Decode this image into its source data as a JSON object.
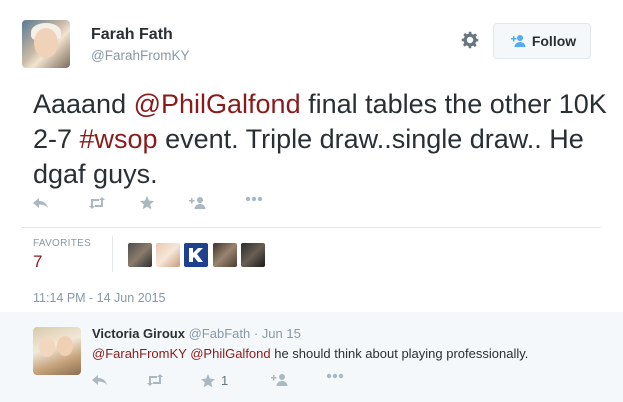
{
  "author": {
    "name": "Farah Fath",
    "handle": "@FarahFromKY",
    "avatar_icon": "profile-photo"
  },
  "header": {
    "settings_icon": "gear-icon",
    "follow_label": "Follow"
  },
  "tweet": {
    "text_before": "Aaaand ",
    "mention": "@PhilGalfond",
    "text_middle": " final tables the other 10K 2-7 ",
    "hashtag": "#wsop",
    "text_after": " event.  Triple draw..single draw.. He dgaf guys."
  },
  "actions": [
    "reply-icon",
    "retweet-icon",
    "favorite-icon",
    "follow-icon",
    "more-icon"
  ],
  "stats": {
    "favorites_label": "FAVORITES",
    "favorites_count": "7"
  },
  "timestamp": "11:14 PM - 14 Jun 2015",
  "reply": {
    "name": "Victoria Giroux",
    "handle": "@FabFath",
    "separator": " · ",
    "date": "Jun 15",
    "mention1": "@FarahFromKY",
    "mention2": "@PhilGalfond",
    "text": " he should think about playing professionally.",
    "favorite_count": "1"
  },
  "colors": {
    "link": "#8b1b1b",
    "muted": "#8899a6",
    "icon": "#aab8c2"
  }
}
